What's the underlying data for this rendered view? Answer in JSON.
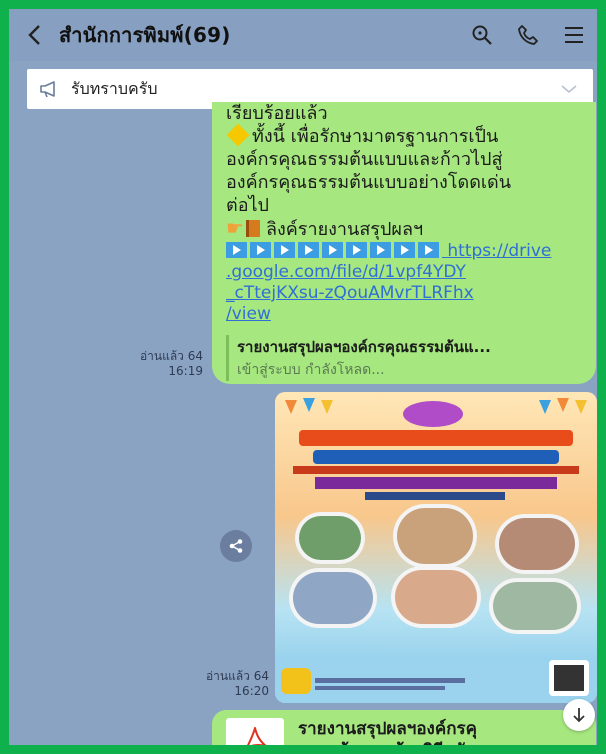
{
  "header": {
    "title": "สำนักการพิมพ์(69)"
  },
  "announcement": {
    "text": "รับทราบครับ"
  },
  "message1": {
    "lines": [
      "เรียบร้อยแล้ว",
      "ทั้งนี้ เพื่อรักษามาตรฐานการเป็น",
      "องค์กรคุณธรรมต้นแบบและก้าวไปสู่",
      "องค์กรคุณธรรมต้นแบบอย่างโดดเด่น",
      "ต่อไป",
      "ลิงค์รายงานสรุปผลฯ"
    ],
    "link_lines": [
      "https://drive",
      ".google.com/file/d/1vpf4YDY",
      "_cTtejKXsu-zQouAMvrTLRFhx",
      "/view"
    ],
    "preview_title": "รายงานสรุปผลฯองค์กรคุณธรรมต้นแ...",
    "preview_sub": "เข้าสู่ระบบ กำลังโหลด...",
    "read_label": "อ่านแล้ว 64",
    "time": "16:19"
  },
  "message2": {
    "read_label": "อ่านแล้ว 64",
    "time": "16:20"
  },
  "message3": {
    "file_title_line1": "รายงานสรุปผลฯองค์กรคุ",
    "file_title_line2": "ธรรมต้นแบบด้วยวิถีกตัญญู"
  },
  "colors": {
    "frame": "#0fb14c",
    "chat_bg": "#8aa3c3",
    "bubble": "#a6e77f",
    "link": "#2f6fd6"
  },
  "icons": [
    "back-icon",
    "search-icon",
    "phone-icon",
    "menu-icon",
    "megaphone-icon",
    "chevron-down-icon",
    "share-icon",
    "pdf-icon",
    "arrow-down-icon"
  ]
}
